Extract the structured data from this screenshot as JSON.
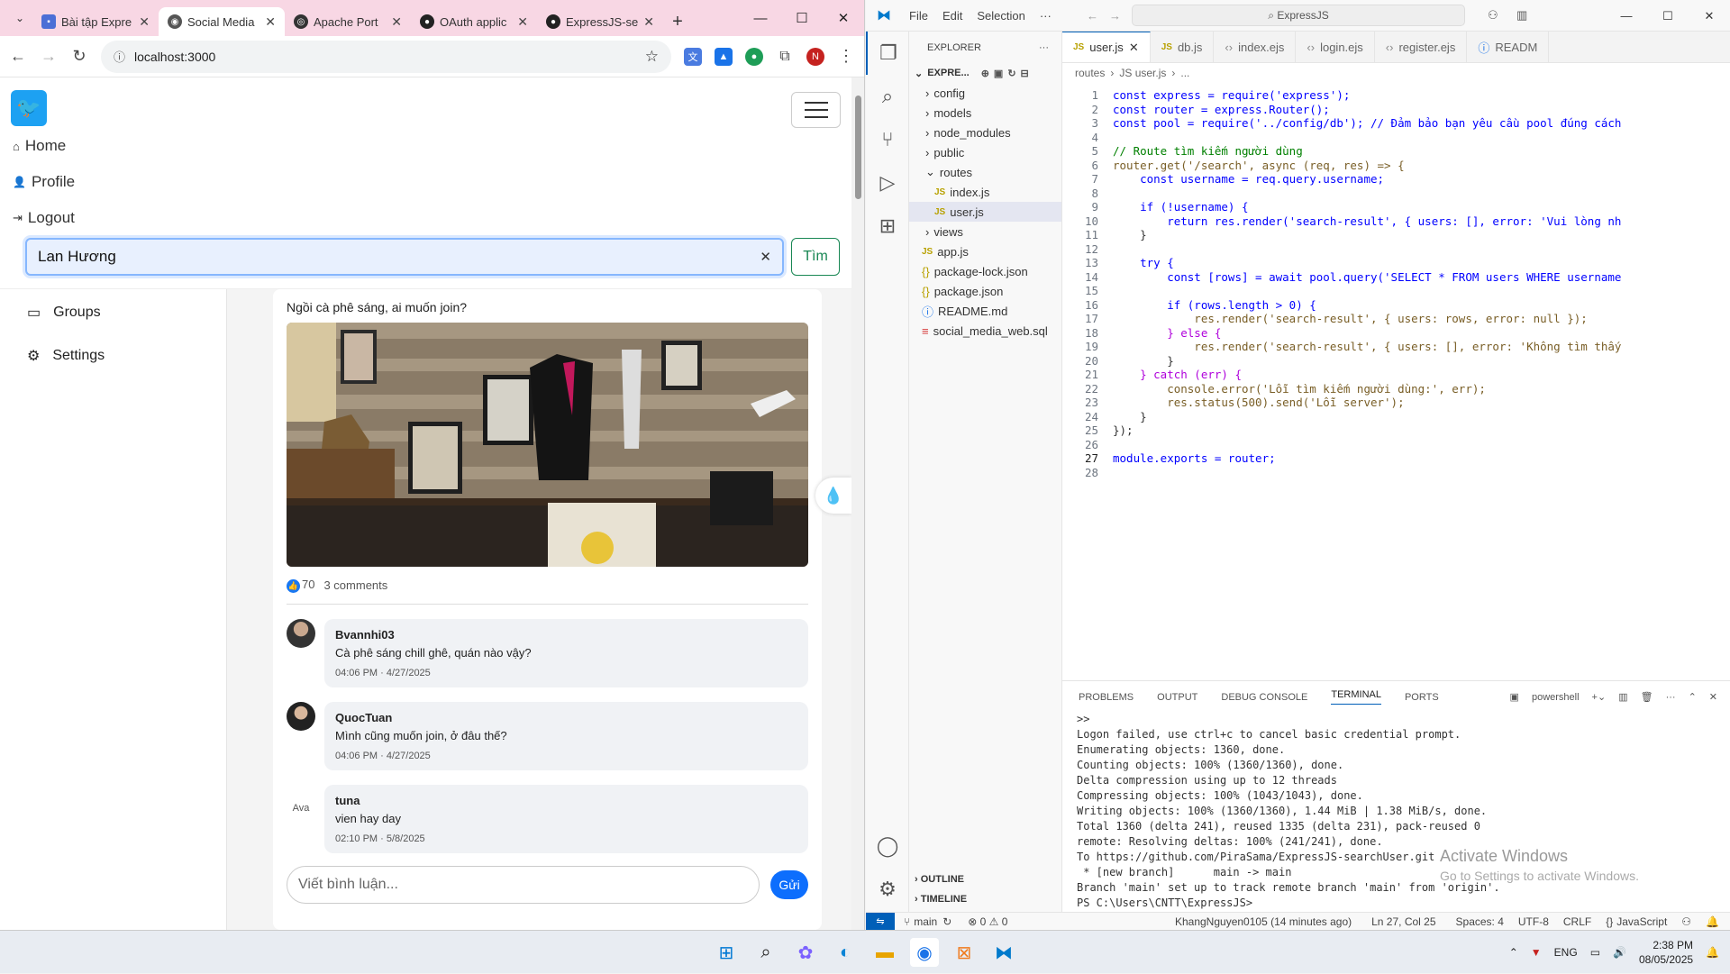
{
  "browser": {
    "tabs": [
      {
        "label": "Bài tập Expre",
        "color": "#4b6fd6"
      },
      {
        "label": "Social Media",
        "color": "#555555"
      },
      {
        "label": "Apache Port",
        "color": "#333333"
      },
      {
        "label": "OAuth applic",
        "color": "#222222"
      },
      {
        "label": "ExpressJS-se",
        "color": "#222222"
      }
    ],
    "url": "localhost:3000",
    "profile_initial": "N"
  },
  "site": {
    "nav": {
      "home": "Home",
      "profile": "Profile",
      "logout": "Logout"
    },
    "search": {
      "value": "Lan Hương",
      "button": "Tìm"
    },
    "sidebar": {
      "groups": "Groups",
      "settings": "Settings"
    },
    "post": {
      "text": "Ngồi cà phê sáng, ai muốn join?",
      "likes": "70",
      "comments_count": "3 comments",
      "comments": [
        {
          "name": "Bvannhi03",
          "text": "Cà phê sáng chill ghê, quán nào vậy?",
          "date": "04:06 PM · 4/27/2025"
        },
        {
          "name": "QuocTuan",
          "text": "Mình cũng muốn join, ở đâu thế?",
          "date": "04:06 PM · 4/27/2025"
        },
        {
          "name": "tuna",
          "text": "vien hay day",
          "date": "02:10 PM · 5/8/2025"
        }
      ],
      "avatar_alt": "Ava",
      "comment_placeholder": "Viết bình luận...",
      "send": "Gửi"
    }
  },
  "vscode": {
    "menu": [
      "File",
      "Edit",
      "Selection",
      "···"
    ],
    "search": "ExpressJS",
    "explorer_title": "EXPLORER",
    "project": "EXPRE...",
    "tree": [
      "config",
      "models",
      "node_modules",
      "public",
      "routes",
      "index.js",
      "user.js",
      "views",
      "app.js",
      "package-lock.json",
      "package.json",
      "README.md",
      "social_media_web.sql"
    ],
    "tabs": [
      "user.js",
      "db.js",
      "index.ejs",
      "login.ejs",
      "register.ejs",
      "READM"
    ],
    "breadcrumb": [
      "routes",
      "JS user.js",
      "..."
    ],
    "code": [
      "const express = require('express');",
      "const router = express.Router();",
      "const pool = require('../config/db'); // Đảm bảo bạn yêu cầu pool đúng cách",
      "",
      "// Route tìm kiếm người dùng",
      "router.get('/search', async (req, res) => {",
      "    const username = req.query.username;",
      "",
      "    if (!username) {",
      "        return res.render('search-result', { users: [], error: 'Vui lòng nh",
      "    }",
      "",
      "    try {",
      "        const [rows] = await pool.query('SELECT * FROM users WHERE username",
      "",
      "        if (rows.length > 0) {",
      "            res.render('search-result', { users: rows, error: null });",
      "        } else {",
      "            res.render('search-result', { users: [], error: 'Không tìm thấy",
      "        }",
      "    } catch (err) {",
      "        console.error('Lỗi tìm kiếm người dùng:', err);",
      "        res.status(500).send('Lỗi server');",
      "    }",
      "});",
      "",
      "module.exports = router;",
      ""
    ],
    "panel_tabs": [
      "PROBLEMS",
      "OUTPUT",
      "DEBUG CONSOLE",
      "TERMINAL",
      "PORTS"
    ],
    "shell": "powershell",
    "terminal": [
      ">>",
      "Logon failed, use ctrl+c to cancel basic credential prompt.",
      "Enumerating objects: 1360, done.",
      "Counting objects: 100% (1360/1360), done.",
      "Delta compression using up to 12 threads",
      "Compressing objects: 100% (1043/1043), done.",
      "Writing objects: 100% (1360/1360), 1.44 MiB | 1.38 MiB/s, done.",
      "Total 1360 (delta 241), reused 1335 (delta 231), pack-reused 0",
      "remote: Resolving deltas: 100% (241/241), done.",
      "To https://github.com/PiraSama/ExpressJS-searchUser.git",
      " * [new branch]      main -> main",
      "Branch 'main' set up to track remote branch 'main' from 'origin'.",
      "PS C:\\Users\\CNTT\\ExpressJS> "
    ],
    "outline": "OUTLINE",
    "timeline": "TIMELINE",
    "status": {
      "branch": "main",
      "problems": "⊗ 0 ⚠ 0",
      "blame": "KhangNguyen0105 (14 minutes ago)",
      "pos": "Ln 27, Col 25",
      "spaces": "Spaces: 4",
      "enc": "UTF-8",
      "eol": "CRLF",
      "lang": "JavaScript"
    },
    "watermark": "Activate Windows",
    "watermark_sub": "Go to Settings to activate Windows."
  },
  "taskbar": {
    "lang": "ENG",
    "time": "2:38 PM",
    "date": "08/05/2025"
  }
}
